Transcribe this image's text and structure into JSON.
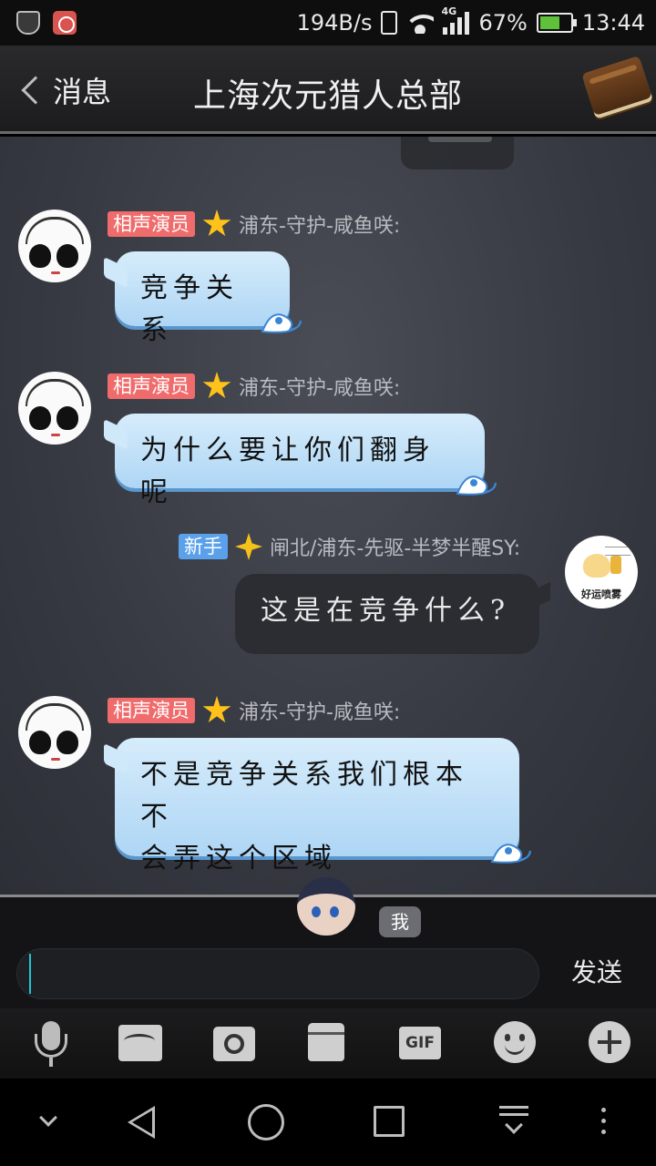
{
  "status_bar": {
    "net_speed": "194B/s",
    "network_type": "4G",
    "battery": "67%",
    "time": "13:44"
  },
  "header": {
    "back_label": "消息",
    "title": "上海次元猎人总部"
  },
  "messages": [
    {
      "side": "left",
      "tag": "相声演员",
      "tag_color": "#f06b6b",
      "sender": "浦东-守护-咸鱼咲:",
      "text": "竞争关系"
    },
    {
      "side": "left",
      "tag": "相声演员",
      "tag_color": "#f06b6b",
      "sender": "浦东-守护-咸鱼咲:",
      "text": "为什么要让你们翻身呢"
    },
    {
      "side": "right",
      "tag": "新手",
      "tag_color": "#5aa0ea",
      "sender": "闸北/浦东-先驱-半梦半醒SY:",
      "text": "这是在竞争什么?",
      "avatar_caption": "好运喷雾"
    },
    {
      "side": "left",
      "tag": "相声演员",
      "tag_color": "#f06b6b",
      "sender": "浦东-守护-咸鱼咲:",
      "text_line1": "不是竞争关系我们根本不",
      "text_line2": "会弄这个区域"
    }
  ],
  "composer": {
    "me_badge": "我",
    "input_value": "",
    "send_label": "发送"
  },
  "toolbar_icons": [
    "microphone-icon",
    "image-icon",
    "camera-icon",
    "bag-icon",
    "gif-icon",
    "emoji-icon",
    "plus-icon"
  ],
  "colors": {
    "bubble_blue": "#aed6f5",
    "bubble_dark": "#2b2d32",
    "caret": "#21c4d6",
    "star": "#ffc21a"
  }
}
